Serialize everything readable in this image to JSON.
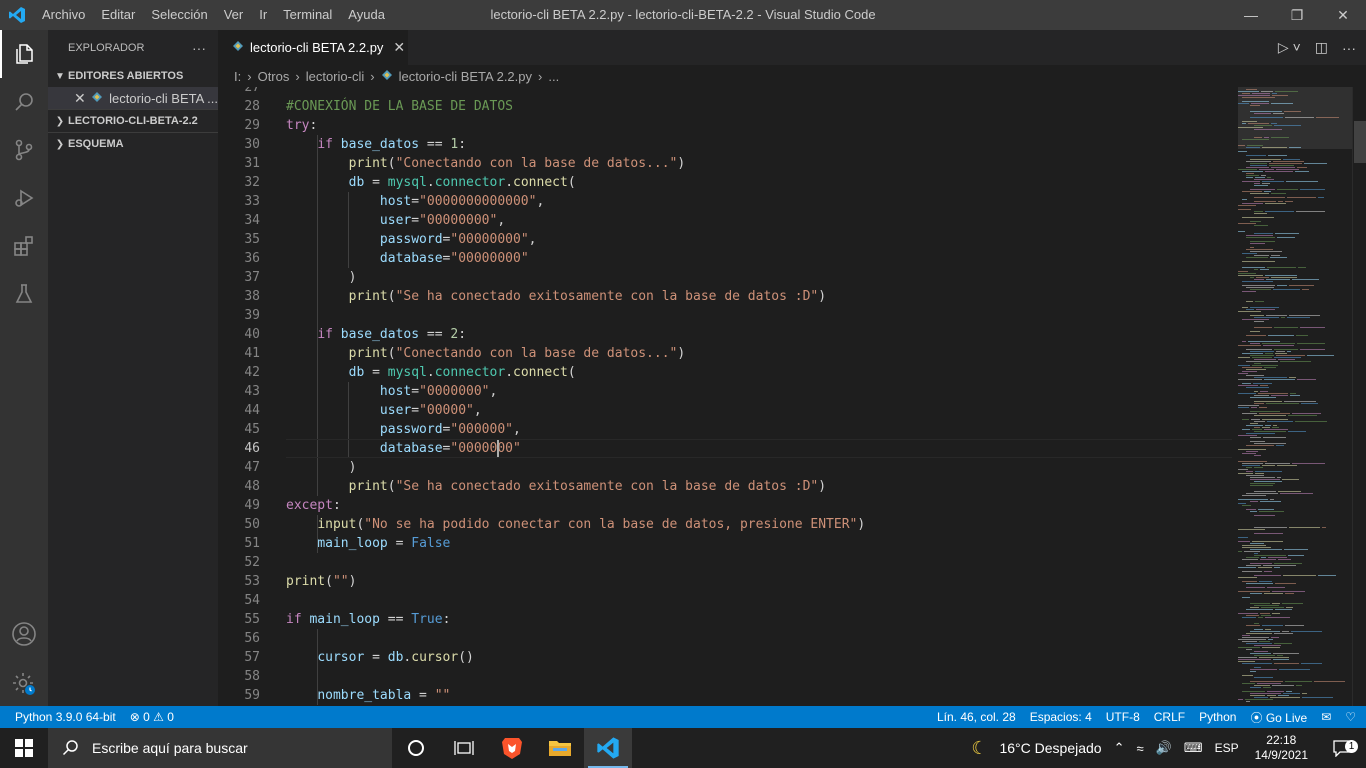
{
  "titlebar": {
    "menu": [
      "Archivo",
      "Editar",
      "Selección",
      "Ver",
      "Ir",
      "Terminal",
      "Ayuda"
    ],
    "title": "lectorio-cli BETA 2.2.py - lectorio-cli-BETA-2.2 - Visual Studio Code",
    "minimize": "—",
    "restore": "❐",
    "close": "✕"
  },
  "sidebar": {
    "header": "EXPLORADOR",
    "more": "···",
    "open_editors": "EDITORES ABIERTOS",
    "open_file": "lectorio-cli BETA ...",
    "project": "LECTORIO-CLI-BETA-2.2",
    "outline": "ESQUEMA"
  },
  "tab": {
    "label": "lectorio-cli BETA 2.2.py"
  },
  "breadcrumb": {
    "drive": "I:",
    "p1": "Otros",
    "p2": "lectorio-cli",
    "file": "lectorio-cli BETA 2.2.py",
    "tail": "..."
  },
  "editor": {
    "current_line": 46,
    "lines": [
      {
        "n": 27,
        "tokens": []
      },
      {
        "n": 28,
        "tokens": [
          [
            "c",
            "#CONEXIÓN DE LA BASE DE DATOS"
          ]
        ]
      },
      {
        "n": 29,
        "tokens": [
          [
            "k",
            "try"
          ],
          [
            "p",
            ":"
          ]
        ]
      },
      {
        "n": 30,
        "tokens": [
          [
            "p",
            "    "
          ],
          [
            "k",
            "if"
          ],
          [
            "p",
            " "
          ],
          [
            "v",
            "base_datos"
          ],
          [
            "p",
            " == "
          ],
          [
            "n",
            "1"
          ],
          [
            "p",
            ":"
          ]
        ]
      },
      {
        "n": 31,
        "tokens": [
          [
            "p",
            "        "
          ],
          [
            "f",
            "print"
          ],
          [
            "p",
            "("
          ],
          [
            "s",
            "\"Conectando con la base de datos...\""
          ],
          [
            "p",
            ")"
          ]
        ]
      },
      {
        "n": 32,
        "tokens": [
          [
            "p",
            "        "
          ],
          [
            "v",
            "db"
          ],
          [
            "p",
            " = "
          ],
          [
            "t",
            "mysql"
          ],
          [
            "p",
            "."
          ],
          [
            "t",
            "connector"
          ],
          [
            "p",
            "."
          ],
          [
            "f",
            "connect"
          ],
          [
            "p",
            "("
          ]
        ]
      },
      {
        "n": 33,
        "tokens": [
          [
            "p",
            "            "
          ],
          [
            "v",
            "host"
          ],
          [
            "p",
            "="
          ],
          [
            "s",
            "\"0000000000000\""
          ],
          [
            "p",
            ","
          ]
        ]
      },
      {
        "n": 34,
        "tokens": [
          [
            "p",
            "            "
          ],
          [
            "v",
            "user"
          ],
          [
            "p",
            "="
          ],
          [
            "s",
            "\"00000000\""
          ],
          [
            "p",
            ","
          ]
        ]
      },
      {
        "n": 35,
        "tokens": [
          [
            "p",
            "            "
          ],
          [
            "v",
            "password"
          ],
          [
            "p",
            "="
          ],
          [
            "s",
            "\"00000000\""
          ],
          [
            "p",
            ","
          ]
        ]
      },
      {
        "n": 36,
        "tokens": [
          [
            "p",
            "            "
          ],
          [
            "v",
            "database"
          ],
          [
            "p",
            "="
          ],
          [
            "s",
            "\"00000000\""
          ]
        ]
      },
      {
        "n": 37,
        "tokens": [
          [
            "p",
            "        )"
          ]
        ]
      },
      {
        "n": 38,
        "tokens": [
          [
            "p",
            "        "
          ],
          [
            "f",
            "print"
          ],
          [
            "p",
            "("
          ],
          [
            "s",
            "\"Se ha conectado exitosamente con la base de datos :D\""
          ],
          [
            "p",
            ")"
          ]
        ]
      },
      {
        "n": 39,
        "tokens": []
      },
      {
        "n": 40,
        "tokens": [
          [
            "p",
            "    "
          ],
          [
            "k",
            "if"
          ],
          [
            "p",
            " "
          ],
          [
            "v",
            "base_datos"
          ],
          [
            "p",
            " == "
          ],
          [
            "n",
            "2"
          ],
          [
            "p",
            ":"
          ]
        ]
      },
      {
        "n": 41,
        "tokens": [
          [
            "p",
            "        "
          ],
          [
            "f",
            "print"
          ],
          [
            "p",
            "("
          ],
          [
            "s",
            "\"Conectando con la base de datos...\""
          ],
          [
            "p",
            ")"
          ]
        ]
      },
      {
        "n": 42,
        "tokens": [
          [
            "p",
            "        "
          ],
          [
            "v",
            "db"
          ],
          [
            "p",
            " = "
          ],
          [
            "t",
            "mysql"
          ],
          [
            "p",
            "."
          ],
          [
            "t",
            "connector"
          ],
          [
            "p",
            "."
          ],
          [
            "f",
            "connect"
          ],
          [
            "p",
            "("
          ]
        ]
      },
      {
        "n": 43,
        "tokens": [
          [
            "p",
            "            "
          ],
          [
            "v",
            "host"
          ],
          [
            "p",
            "="
          ],
          [
            "s",
            "\"0000000\""
          ],
          [
            "p",
            ","
          ]
        ]
      },
      {
        "n": 44,
        "tokens": [
          [
            "p",
            "            "
          ],
          [
            "v",
            "user"
          ],
          [
            "p",
            "="
          ],
          [
            "s",
            "\"00000\""
          ],
          [
            "p",
            ","
          ]
        ]
      },
      {
        "n": 45,
        "tokens": [
          [
            "p",
            "            "
          ],
          [
            "v",
            "password"
          ],
          [
            "p",
            "="
          ],
          [
            "s",
            "\"000000\""
          ],
          [
            "p",
            ","
          ]
        ]
      },
      {
        "n": 46,
        "tokens": [
          [
            "p",
            "            "
          ],
          [
            "v",
            "database"
          ],
          [
            "p",
            "="
          ],
          [
            "s",
            "\"0000000\""
          ]
        ]
      },
      {
        "n": 47,
        "tokens": [
          [
            "p",
            "        )"
          ]
        ]
      },
      {
        "n": 48,
        "tokens": [
          [
            "p",
            "        "
          ],
          [
            "f",
            "print"
          ],
          [
            "p",
            "("
          ],
          [
            "s",
            "\"Se ha conectado exitosamente con la base de datos :D\""
          ],
          [
            "p",
            ")"
          ]
        ]
      },
      {
        "n": 49,
        "tokens": [
          [
            "k",
            "except"
          ],
          [
            "p",
            ":"
          ]
        ]
      },
      {
        "n": 50,
        "tokens": [
          [
            "p",
            "    "
          ],
          [
            "f",
            "input"
          ],
          [
            "p",
            "("
          ],
          [
            "s",
            "\"No se ha podido conectar con la base de datos, presione ENTER\""
          ],
          [
            "p",
            ")"
          ]
        ]
      },
      {
        "n": 51,
        "tokens": [
          [
            "p",
            "    "
          ],
          [
            "v",
            "main_loop"
          ],
          [
            "p",
            " = "
          ],
          [
            "b",
            "False"
          ]
        ]
      },
      {
        "n": 52,
        "tokens": []
      },
      {
        "n": 53,
        "tokens": [
          [
            "f",
            "print"
          ],
          [
            "p",
            "("
          ],
          [
            "s",
            "\"\""
          ],
          [
            "p",
            ")"
          ]
        ]
      },
      {
        "n": 54,
        "tokens": []
      },
      {
        "n": 55,
        "tokens": [
          [
            "k",
            "if"
          ],
          [
            "p",
            " "
          ],
          [
            "v",
            "main_loop"
          ],
          [
            "p",
            " == "
          ],
          [
            "b",
            "True"
          ],
          [
            "p",
            ":"
          ]
        ]
      },
      {
        "n": 56,
        "tokens": []
      },
      {
        "n": 57,
        "tokens": [
          [
            "p",
            "    "
          ],
          [
            "v",
            "cursor"
          ],
          [
            "p",
            " = "
          ],
          [
            "v",
            "db"
          ],
          [
            "p",
            "."
          ],
          [
            "f",
            "cursor"
          ],
          [
            "p",
            "()"
          ]
        ]
      },
      {
        "n": 58,
        "tokens": []
      },
      {
        "n": 59,
        "tokens": [
          [
            "p",
            "    "
          ],
          [
            "v",
            "nombre_tabla"
          ],
          [
            "p",
            " = "
          ],
          [
            "s",
            "\"\""
          ]
        ]
      }
    ]
  },
  "statusbar": {
    "python": "Python 3.9.0 64-bit",
    "errors": "⊗ 0 ⚠ 0",
    "position": "Lín. 46, col. 28",
    "spaces": "Espacios: 4",
    "encoding": "UTF-8",
    "eol": "CRLF",
    "language": "Python",
    "golive": "Go Live"
  },
  "taskbar": {
    "search_placeholder": "Escribe aquí para buscar",
    "weather": "16°C  Despejado",
    "lang": "ESP",
    "time": "22:18",
    "date": "14/9/2021",
    "notif_count": "1"
  },
  "colors": {
    "accent": "#007acc",
    "keyword": "#c586c0",
    "string": "#ce9178",
    "function": "#dcdcaa",
    "variable": "#9cdcfe",
    "comment": "#6a9955"
  }
}
